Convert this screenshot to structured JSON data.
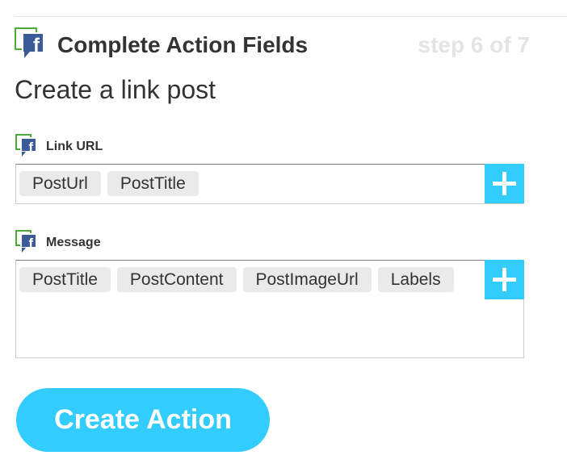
{
  "header": {
    "title": "Complete Action Fields",
    "step": "step 6 of 7",
    "channel_icon": "facebook-pages-icon",
    "channel_icon_letter": "f"
  },
  "action": {
    "title": "Create a link post"
  },
  "fields": [
    {
      "label": "Link URL",
      "icon": "facebook-pages-icon",
      "icon_letter": "f",
      "ingredients": [
        "PostUrl",
        "PostTitle"
      ],
      "add_icon": "plus-icon"
    },
    {
      "label": "Message",
      "icon": "facebook-pages-icon",
      "icon_letter": "f",
      "ingredients": [
        "PostTitle",
        "PostContent",
        "PostImageUrl",
        "Labels"
      ],
      "add_icon": "plus-icon"
    }
  ],
  "buttons": {
    "create_action": "Create Action"
  },
  "colors": {
    "accent": "#33ccff",
    "pill_bg": "#eaeaea",
    "text": "#333333",
    "step_text": "#e4e4e4",
    "facebook_blue": "#3b5b98",
    "icon_green": "#4caa39"
  }
}
